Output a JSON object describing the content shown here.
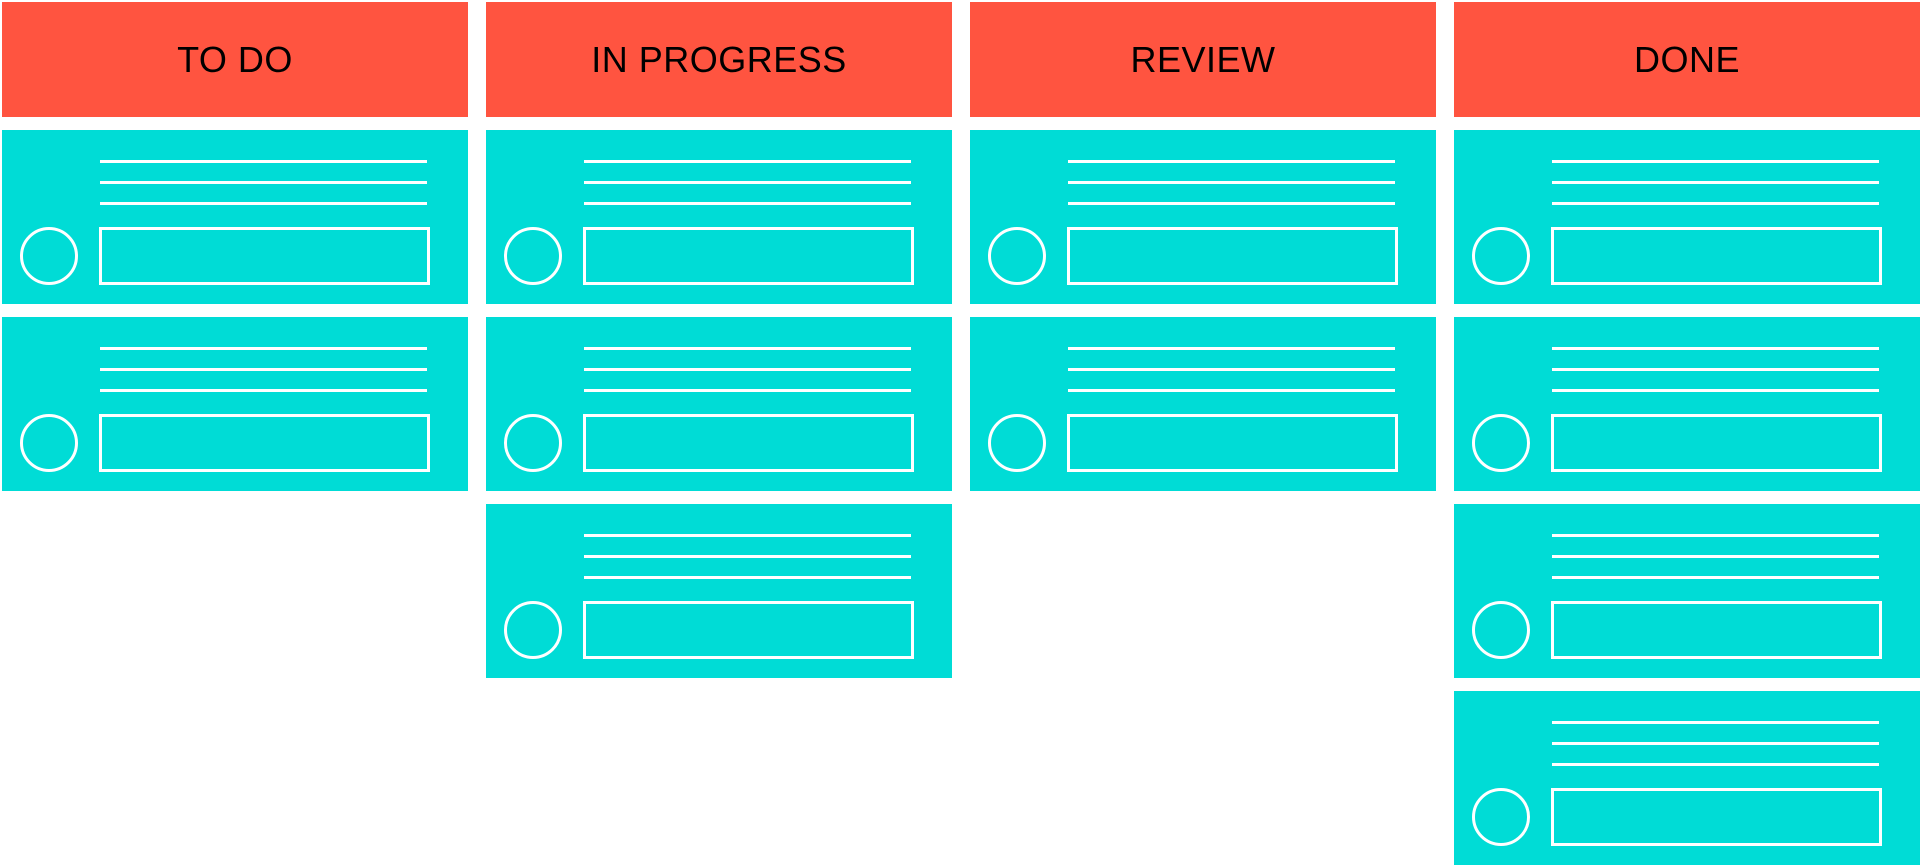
{
  "board": {
    "header_color": "#FF5440",
    "card_color": "#00DCD6",
    "columns": [
      {
        "title": "TO DO",
        "card_count": 2
      },
      {
        "title": "IN PROGRESS",
        "card_count": 3
      },
      {
        "title": "REVIEW",
        "card_count": 2
      },
      {
        "title": "DONE",
        "card_count": 4
      }
    ]
  }
}
